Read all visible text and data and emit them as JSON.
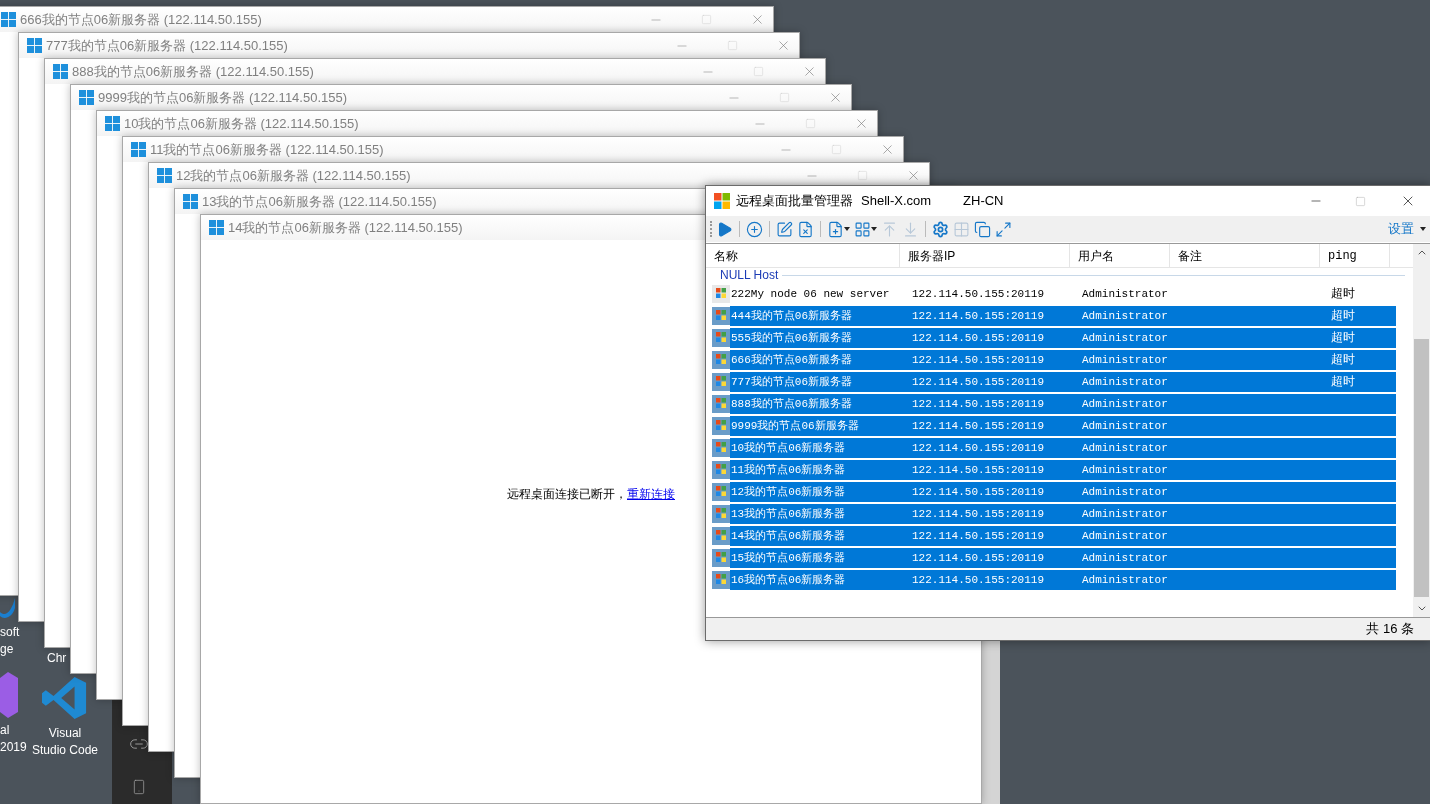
{
  "desktop_icons": [
    {
      "kind": "edge",
      "lines": [
        "soft",
        "ge"
      ]
    },
    {
      "kind": "chrome",
      "lines": [
        "Chr"
      ]
    },
    {
      "kind": "vs",
      "lines": [
        "al",
        "2019"
      ]
    },
    {
      "kind": "vscode",
      "lines": [
        "Visual",
        "Studio Code"
      ]
    }
  ],
  "rdp_windows": [
    {
      "title": "666我的节点06新服务器 (122.114.50.155)"
    },
    {
      "title": "777我的节点06新服务器 (122.114.50.155)"
    },
    {
      "title": "888我的节点06新服务器 (122.114.50.155)"
    },
    {
      "title": "9999我的节点06新服务器 (122.114.50.155)"
    },
    {
      "title": "10我的节点06新服务器 (122.114.50.155)"
    },
    {
      "title": "11我的节点06新服务器 (122.114.50.155)"
    },
    {
      "title": "12我的节点06新服务器 (122.114.50.155)"
    },
    {
      "title": "13我的节点06新服务器 (122.114.50.155)"
    },
    {
      "title": "14我的节点06新服务器 (122.114.50.155)",
      "notice": {
        "text": "远程桌面连接已断开，",
        "link": "重新连接"
      }
    }
  ],
  "manager": {
    "title": "远程桌面批量管理器",
    "site": "Shell-X.com",
    "language": "ZH-CN",
    "toolbar": [
      {
        "kind": "play",
        "disabled": false
      },
      {
        "kind": "sep"
      },
      {
        "kind": "add",
        "disabled": false
      },
      {
        "kind": "sep"
      },
      {
        "kind": "edit",
        "disabled": false
      },
      {
        "kind": "delete",
        "disabled": false
      },
      {
        "kind": "sep"
      },
      {
        "kind": "import",
        "disabled": false
      },
      {
        "kind": "layout",
        "disabled": false
      },
      {
        "kind": "move-up",
        "disabled": true
      },
      {
        "kind": "move-down",
        "disabled": true
      },
      {
        "kind": "sep"
      },
      {
        "kind": "gear",
        "disabled": false
      },
      {
        "kind": "tile",
        "disabled": true
      },
      {
        "kind": "cascade",
        "disabled": false
      },
      {
        "kind": "fit",
        "disabled": false
      }
    ],
    "settings": "设置",
    "columns": [
      "名称",
      "服务器IP",
      "用户名",
      "备注",
      "ping"
    ],
    "group": "NULL Host",
    "rows": [
      {
        "name": "222My node 06 new server",
        "ip": "122.114.50.155:20119",
        "user": "Administrator",
        "ping": "超时",
        "selected": false
      },
      {
        "name": "444我的节点06新服务器",
        "ip": "122.114.50.155:20119",
        "user": "Administrator",
        "ping": "超时",
        "selected": true
      },
      {
        "name": "555我的节点06新服务器",
        "ip": "122.114.50.155:20119",
        "user": "Administrator",
        "ping": "超时",
        "selected": true
      },
      {
        "name": "666我的节点06新服务器",
        "ip": "122.114.50.155:20119",
        "user": "Administrator",
        "ping": "超时",
        "selected": true
      },
      {
        "name": "777我的节点06新服务器",
        "ip": "122.114.50.155:20119",
        "user": "Administrator",
        "ping": "超时",
        "selected": true
      },
      {
        "name": "888我的节点06新服务器",
        "ip": "122.114.50.155:20119",
        "user": "Administrator",
        "selected": true
      },
      {
        "name": "9999我的节点06新服务器",
        "ip": "122.114.50.155:20119",
        "user": "Administrator",
        "selected": true
      },
      {
        "name": "10我的节点06新服务器",
        "ip": "122.114.50.155:20119",
        "user": "Administrator",
        "selected": true
      },
      {
        "name": "11我的节点06新服务器",
        "ip": "122.114.50.155:20119",
        "user": "Administrator",
        "selected": true
      },
      {
        "name": "12我的节点06新服务器",
        "ip": "122.114.50.155:20119",
        "user": "Administrator",
        "selected": true
      },
      {
        "name": "13我的节点06新服务器",
        "ip": "122.114.50.155:20119",
        "user": "Administrator",
        "selected": true
      },
      {
        "name": "14我的节点06新服务器",
        "ip": "122.114.50.155:20119",
        "user": "Administrator",
        "selected": true
      },
      {
        "name": "15我的节点06新服务器",
        "ip": "122.114.50.155:20119",
        "user": "Administrator",
        "selected": true
      },
      {
        "name": "16我的节点06新服务器",
        "ip": "122.114.50.155:20119",
        "user": "Administrator",
        "selected": true
      }
    ],
    "status": "共 16 条"
  }
}
